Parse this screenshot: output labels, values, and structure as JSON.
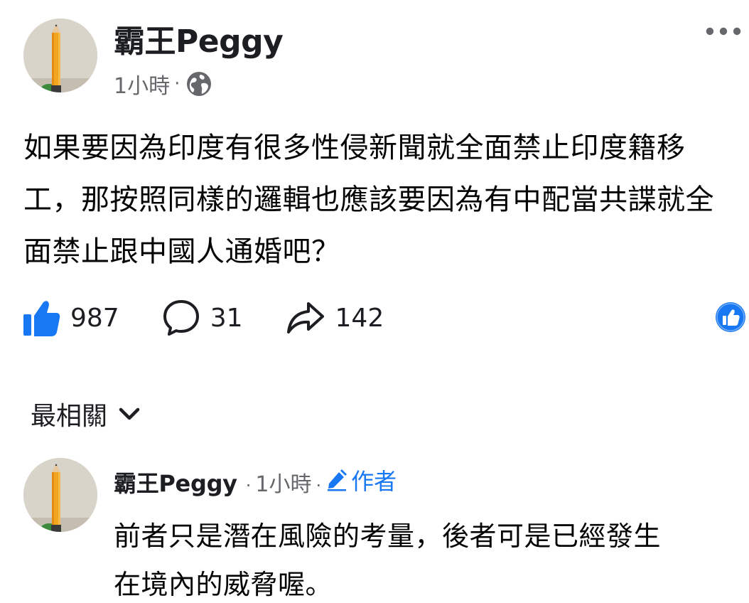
{
  "post": {
    "author_name": "霸王Peggy",
    "timestamp": "1小時",
    "meta_separator": "·",
    "text": "如果要因為印度有很多性侵新聞就全面禁止印度籍移工，那按照同樣的邏輯也應該要因為有中配當共諜就全面禁止跟中國人通婚吧？",
    "icons": {
      "privacy": "globe-icon",
      "menu": "more-horizontal-icon"
    }
  },
  "actions": {
    "like_count": "987",
    "comment_count": "31",
    "share_count": "142",
    "icons": {
      "like": "thumbs-up-icon",
      "comment": "comment-bubble-icon",
      "share": "share-arrow-icon",
      "reaction_badge": "like-reaction-badge-icon"
    }
  },
  "sort": {
    "label": "最相關",
    "icon": "chevron-down-icon"
  },
  "comments": [
    {
      "author_name": "霸王Peggy",
      "separator": "·",
      "timestamp": "1小時",
      "badge_label": "作者",
      "badge_icon": "pencil-icon",
      "text_lines": [
        "前者只是潛在風險的考量，後者可是已經發生",
        "在境內的威脅喔。"
      ]
    }
  ],
  "colors": {
    "text": "#050505",
    "secondary_text": "#65676b",
    "facebook_blue": "#1877f2",
    "background": "#ffffff"
  }
}
